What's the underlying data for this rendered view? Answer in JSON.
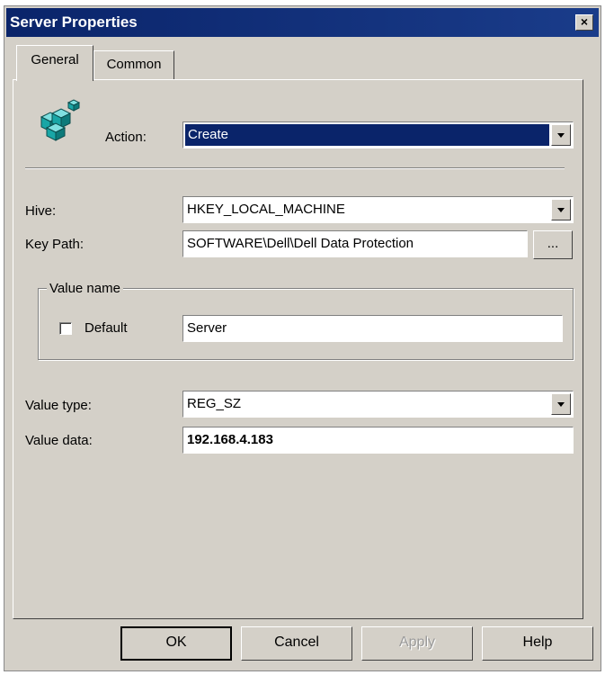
{
  "window": {
    "title": "Server Properties",
    "close_glyph": "×"
  },
  "tabs": [
    {
      "label": "General",
      "active": true
    },
    {
      "label": "Common",
      "active": false
    }
  ],
  "icon": {
    "name": "registry-cubes-icon"
  },
  "action": {
    "label": "Action:",
    "value": "Create"
  },
  "hive": {
    "label": "Hive:",
    "value": "HKEY_LOCAL_MACHINE"
  },
  "key_path": {
    "label": "Key Path:",
    "value": "SOFTWARE\\Dell\\Dell Data Protection",
    "browse_label": "..."
  },
  "value_name": {
    "group_title": "Value name",
    "default_label": "Default",
    "default_checked": false,
    "value": "Server"
  },
  "value_type": {
    "label": "Value type:",
    "value": "REG_SZ"
  },
  "value_data": {
    "label": "Value data:",
    "value": "192.168.4.183"
  },
  "buttons": {
    "ok": "OK",
    "cancel": "Cancel",
    "apply": "Apply",
    "help": "Help"
  },
  "colors": {
    "titlebar": "#0a246a",
    "face": "#d4d0c8",
    "selection": "#0a246a"
  }
}
